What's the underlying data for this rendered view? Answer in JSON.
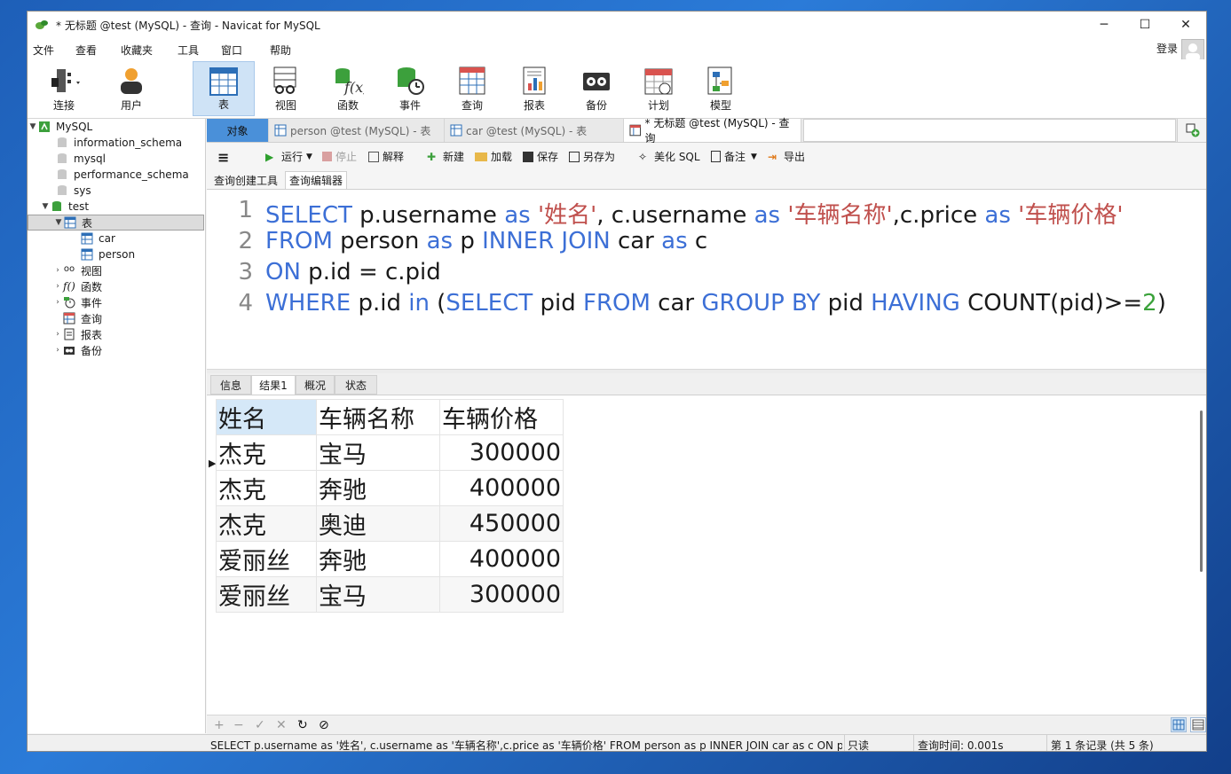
{
  "window": {
    "title": "* 无标题 @test (MySQL) - 查询 - Navicat for MySQL",
    "minimize": "─",
    "maximize": "☐",
    "close": "✕"
  },
  "menu": [
    "文件",
    "查看",
    "收藏夹",
    "工具",
    "窗口",
    "帮助"
  ],
  "login": "登录",
  "toolbar": [
    {
      "label": "连接",
      "icon": "connection-icon"
    },
    {
      "label": "用户",
      "icon": "user-icon"
    },
    {
      "label": "表",
      "icon": "table-icon",
      "active": true
    },
    {
      "label": "视图",
      "icon": "view-icon"
    },
    {
      "label": "函数",
      "icon": "function-icon"
    },
    {
      "label": "事件",
      "icon": "event-icon"
    },
    {
      "label": "查询",
      "icon": "query-icon"
    },
    {
      "label": "报表",
      "icon": "report-icon"
    },
    {
      "label": "备份",
      "icon": "backup-icon"
    },
    {
      "label": "计划",
      "icon": "schedule-icon"
    },
    {
      "label": "模型",
      "icon": "model-icon"
    }
  ],
  "tree": {
    "connection": "MySQL",
    "databases": [
      "information_schema",
      "mysql",
      "performance_schema",
      "sys",
      "test"
    ],
    "tables_node": "表",
    "tables": [
      "car",
      "person"
    ],
    "nodes": [
      "视图",
      "函数",
      "事件",
      "查询",
      "报表",
      "备份"
    ]
  },
  "tabs": {
    "objects": "对象",
    "t1": "person @test (MySQL) - 表",
    "t2": "car @test (MySQL) - 表",
    "t3": "* 无标题 @test (MySQL) - 查询"
  },
  "query_toolbar": {
    "run": "运行",
    "stop": "停止",
    "explain": "解释",
    "new": "新建",
    "load": "加载",
    "save": "保存",
    "save_as": "另存为",
    "beautify": "美化 SQL",
    "comment": "备注",
    "export": "导出"
  },
  "subtabs": [
    "查询创建工具",
    "查询编辑器"
  ],
  "sql_line_numbers": [
    "1",
    "2",
    "3",
    "4"
  ],
  "sql": {
    "l1": [
      "SELECT",
      " p.username ",
      "as",
      " ",
      "'姓名'",
      ", c.username ",
      "as",
      " ",
      "'车辆名称'",
      ",c.price ",
      "as",
      " ",
      "'车辆价格'"
    ],
    "l2": [
      "FROM",
      " person ",
      "as",
      " p ",
      "INNER JOIN",
      " car ",
      "as",
      " c"
    ],
    "l3": [
      "ON",
      " p.id = c.pid"
    ],
    "l4": [
      "WHERE",
      " p.id ",
      "in",
      " (",
      "SELECT",
      " pid ",
      "FROM",
      " car ",
      "GROUP BY",
      " pid ",
      "HAVING",
      " COUNT(pid)>=",
      "2",
      ")"
    ]
  },
  "result_tabs": [
    "信息",
    "结果1",
    "概况",
    "状态"
  ],
  "results": {
    "columns": [
      "姓名",
      "车辆名称",
      "车辆价格"
    ],
    "rows": [
      [
        "杰克",
        "宝马",
        "300000"
      ],
      [
        "杰克",
        "奔驰",
        "400000"
      ],
      [
        "杰克",
        "奥迪",
        "450000"
      ],
      [
        "爱丽丝",
        "奔驰",
        "400000"
      ],
      [
        "爱丽丝",
        "宝马",
        "300000"
      ]
    ]
  },
  "grid_footer": [
    "+",
    "−",
    "✓",
    "✕",
    "↻",
    "⊘"
  ],
  "status": {
    "sql": "SELECT p.username as '姓名', c.username as '车辆名称',c.price as '车辆价格' FROM person as p INNER JOIN car as c ON p.",
    "mode": "只读",
    "time": "查询时间: 0.001s",
    "records": "第 1 条记录 (共 5 条)"
  }
}
